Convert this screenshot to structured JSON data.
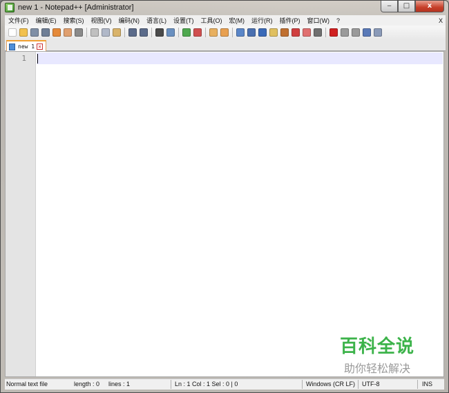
{
  "window": {
    "title": "new 1 - Notepad++ [Administrator]",
    "minimize_glyph": "‒",
    "maximize_glyph": "□",
    "close_glyph": "x"
  },
  "menu": {
    "items": [
      "文件(F)",
      "编辑(E)",
      "搜索(S)",
      "视图(V)",
      "编码(N)",
      "语言(L)",
      "设置(T)",
      "工具(O)",
      "宏(M)",
      "运行(R)",
      "插件(P)",
      "窗口(W)",
      "?"
    ],
    "close_label": "X"
  },
  "toolbar": {
    "icons": [
      {
        "name": "new-file-icon",
        "color": "#ffffff"
      },
      {
        "name": "open-file-icon",
        "color": "#f2c14e"
      },
      {
        "name": "save-icon",
        "color": "#7f8fa6"
      },
      {
        "name": "save-all-icon",
        "color": "#6f7f96"
      },
      {
        "name": "close-file-icon",
        "color": "#e58a3a"
      },
      {
        "name": "close-all-icon",
        "color": "#e0a070"
      },
      {
        "name": "print-icon",
        "color": "#8a8a8a"
      },
      {
        "sep": true
      },
      {
        "name": "cut-icon",
        "color": "#c0c0c0"
      },
      {
        "name": "copy-icon",
        "color": "#b0b8c8"
      },
      {
        "name": "paste-icon",
        "color": "#d9b36a"
      },
      {
        "sep": true
      },
      {
        "name": "undo-icon",
        "color": "#5b6b8a"
      },
      {
        "name": "redo-icon",
        "color": "#5b6b8a"
      },
      {
        "sep": true
      },
      {
        "name": "find-icon",
        "color": "#4a4a4a"
      },
      {
        "name": "replace-icon",
        "color": "#6a90c0"
      },
      {
        "sep": true
      },
      {
        "name": "zoom-in-icon",
        "color": "#4fa84f"
      },
      {
        "name": "zoom-out-icon",
        "color": "#d05050"
      },
      {
        "sep": true
      },
      {
        "name": "sync-vertical-icon",
        "color": "#e8b060"
      },
      {
        "name": "sync-horizontal-icon",
        "color": "#e8a050"
      },
      {
        "sep": true
      },
      {
        "name": "word-wrap-icon",
        "color": "#5a86c8"
      },
      {
        "name": "show-all-chars-icon",
        "color": "#4a70b0"
      },
      {
        "name": "indent-guide-icon",
        "color": "#3a6ab8"
      },
      {
        "name": "user-language-icon",
        "color": "#e0c060"
      },
      {
        "name": "document-map-icon",
        "color": "#c07030"
      },
      {
        "name": "function-list-icon",
        "color": "#d04040"
      },
      {
        "name": "folder-workspace-icon",
        "color": "#e07070"
      },
      {
        "name": "monitoring-icon",
        "color": "#707070"
      },
      {
        "sep": true
      },
      {
        "name": "record-macro-icon",
        "color": "#d02020"
      },
      {
        "name": "stop-macro-icon",
        "color": "#9a9a9a"
      },
      {
        "name": "play-macro-icon",
        "color": "#9a9a9a"
      },
      {
        "name": "run-macro-multiple-icon",
        "color": "#5a7ab8"
      },
      {
        "name": "save-macro-icon",
        "color": "#8a9ab8"
      }
    ]
  },
  "tabs": [
    {
      "label": "new 1",
      "close_glyph": "×"
    }
  ],
  "editor": {
    "line_numbers": [
      "1"
    ]
  },
  "watermark": {
    "main": "百科全说",
    "sub": "助你轻松解决"
  },
  "status": {
    "file_type": "Normal text file",
    "length": "length : 0",
    "lines": "lines : 1",
    "position": "Ln : 1    Col : 1    Sel : 0 | 0",
    "eol": "Windows (CR LF)",
    "encoding": "UTF-8",
    "mode": "INS"
  }
}
